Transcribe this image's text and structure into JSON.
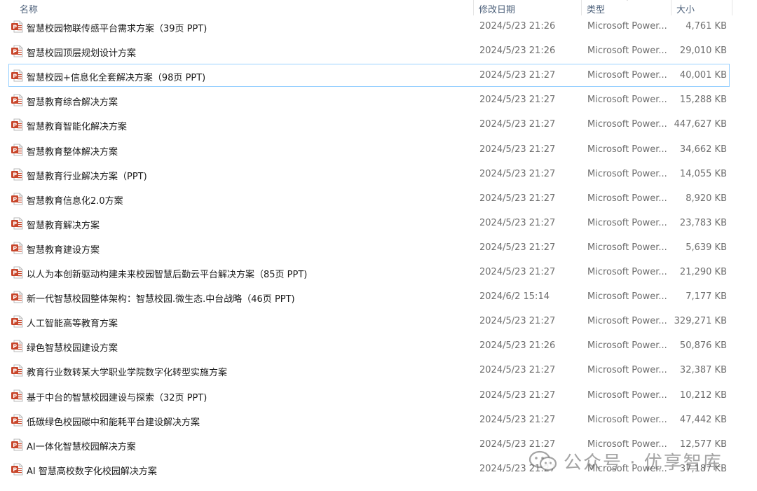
{
  "header": {
    "name_label": "名称",
    "date_label": "修改日期",
    "type_label": "类型",
    "size_label": "大小"
  },
  "files": [
    {
      "name": "智慧校园物联传感平台需求方案（39页 PPT)",
      "date": "2024/5/23 21:26",
      "type": "Microsoft Power...",
      "size": "4,761 KB",
      "icon": "pptx-file-icon"
    },
    {
      "name": "智慧校园顶层规划设计方案",
      "date": "2024/5/23 21:26",
      "type": "Microsoft Power...",
      "size": "29,010 KB",
      "icon": "pptx-file-icon"
    },
    {
      "name": "智慧校园+信息化全套解决方案（98页 PPT)",
      "date": "2024/5/23 21:27",
      "type": "Microsoft Power...",
      "size": "40,001 KB",
      "icon": "pptx-file-icon",
      "selected": true
    },
    {
      "name": "智慧教育综合解决方案",
      "date": "2024/5/23 21:27",
      "type": "Microsoft Power...",
      "size": "15,288 KB",
      "icon": "pptx-file-icon"
    },
    {
      "name": "智慧教育智能化解决方案",
      "date": "2024/5/23 21:27",
      "type": "Microsoft Power...",
      "size": "447,627 KB",
      "icon": "pptx-file-icon"
    },
    {
      "name": "智慧教育整体解决方案",
      "date": "2024/5/23 21:27",
      "type": "Microsoft Power...",
      "size": "34,662 KB",
      "icon": "pptx-file-icon"
    },
    {
      "name": "智慧教育行业解决方案（PPT)",
      "date": "2024/5/23 21:27",
      "type": "Microsoft Power...",
      "size": "14,055 KB",
      "icon": "pptx-file-icon"
    },
    {
      "name": "智慧教育信息化2.0方案",
      "date": "2024/5/23 21:27",
      "type": "Microsoft Power...",
      "size": "8,920 KB",
      "icon": "pptx-file-icon"
    },
    {
      "name": "智慧教育解决方案",
      "date": "2024/5/23 21:27",
      "type": "Microsoft Power...",
      "size": "23,783 KB",
      "icon": "pptx-file-icon"
    },
    {
      "name": "智慧教育建设方案",
      "date": "2024/5/23 21:27",
      "type": "Microsoft Power...",
      "size": "5,639 KB",
      "icon": "pptx-file-icon"
    },
    {
      "name": "以人为本创新驱动构建未来校园智慧后勤云平台解决方案（85页 PPT)",
      "date": "2024/5/23 21:27",
      "type": "Microsoft Power...",
      "size": "21,290 KB",
      "icon": "pptx-file-icon"
    },
    {
      "name": "新一代智慧校园整体架构：智慧校园.微生态.中台战略（46页 PPT)",
      "date": "2024/6/2 15:14",
      "type": "Microsoft Power...",
      "size": "7,177 KB",
      "icon": "pptx-file-icon"
    },
    {
      "name": "人工智能高等教育方案",
      "date": "2024/5/23 21:27",
      "type": "Microsoft Power...",
      "size": "329,271 KB",
      "icon": "pptx-file-icon"
    },
    {
      "name": "绿色智慧校园建设方案",
      "date": "2024/5/23 21:26",
      "type": "Microsoft Power...",
      "size": "50,876 KB",
      "icon": "pptx-file-icon"
    },
    {
      "name": "教育行业数转某大学职业学院数字化转型实施方案",
      "date": "2024/5/23 21:27",
      "type": "Microsoft Power...",
      "size": "32,387 KB",
      "icon": "pptx-file-icon"
    },
    {
      "name": "基于中台的智慧校园建设与探索（32页 PPT)",
      "date": "2024/5/23 21:27",
      "type": "Microsoft Power...",
      "size": "10,212 KB",
      "icon": "pptx-file-icon"
    },
    {
      "name": "低碳绿色校园碳中和能耗平台建设解决方案",
      "date": "2024/5/23 21:27",
      "type": "Microsoft Power...",
      "size": "47,442 KB",
      "icon": "pptx-file-icon"
    },
    {
      "name": "AI一体化智慧校园解决方案",
      "date": "2024/5/23 21:27",
      "type": "Microsoft Power...",
      "size": "12,577 KB",
      "icon": "pptx-file-icon"
    },
    {
      "name": "AI 智慧高校数字化校园解决方案",
      "date": "2024/5/23 21:27",
      "type": "Microsoft Power...",
      "size": "37,187 KB",
      "icon": "pptx-file-icon"
    }
  ],
  "watermark": {
    "text": "公众号 · 优享智库",
    "icon": "wechat-icon"
  },
  "colors": {
    "header_text": "#4c607a",
    "selected_border": "#99d1ff",
    "ppt_icon": "#c8462b",
    "secondary_text": "#6d6d6d"
  }
}
